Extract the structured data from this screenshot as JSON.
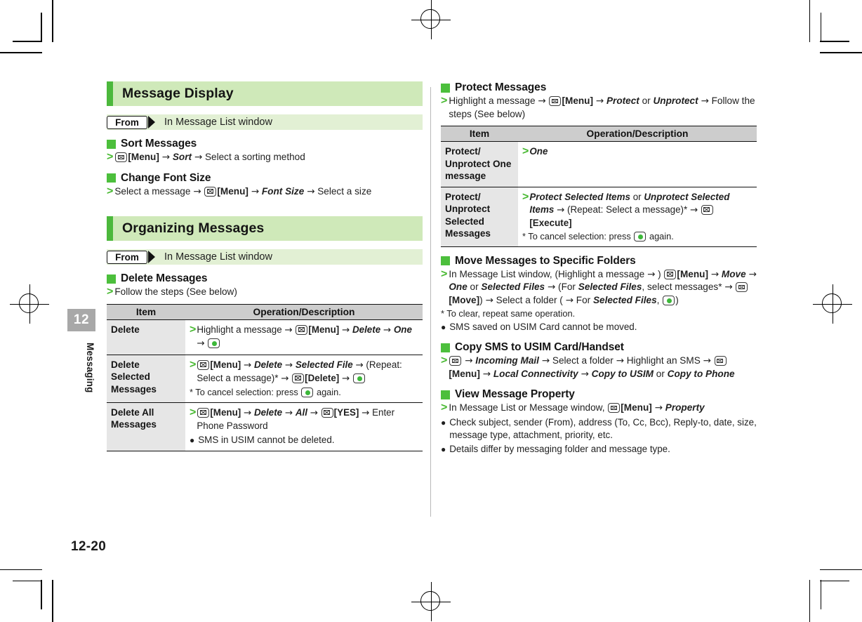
{
  "page": {
    "folio": "12-20",
    "chapter_number": "12",
    "chapter_label": "Messaging"
  },
  "left_column": {
    "sections": [
      {
        "banner_title": "Message Display",
        "from_badge": "From",
        "from_text": "In Message List window",
        "topics": [
          {
            "heading": "Sort Messages",
            "step": "[Menu] → Sort → Select a sorting method"
          },
          {
            "heading": "Change Font Size",
            "step": "Select a message → [Menu] → Font Size → Select a size"
          }
        ]
      },
      {
        "banner_title": "Organizing Messages",
        "from_badge": "From",
        "from_text": "In Message List window",
        "topics": [
          {
            "heading": "Delete Messages",
            "step": "Follow the steps (See below)"
          }
        ]
      }
    ],
    "table": {
      "columns": [
        "Item",
        "Operation/Description"
      ],
      "rows": [
        {
          "item": "Delete",
          "operation": "Highlight a message → [Menu] → Delete → One →",
          "note": "",
          "bullet": ""
        },
        {
          "item": "Delete Selected Messages",
          "operation": "[Menu] → Delete → Selected File → (Repeat: Select a message)* → [Delete] →",
          "note": "* To cancel selection: press  again.",
          "bullet": ""
        },
        {
          "item": "Delete All Messages",
          "operation": "[Menu] → Delete → All → [YES] → Enter Phone Password",
          "note": "",
          "bullet": "SMS in USIM cannot be deleted."
        }
      ]
    }
  },
  "right_column": {
    "protect": {
      "heading": "Protect Messages",
      "step": "Highlight a message → [Menu] → Protect or Unprotect → Follow the steps (See below)",
      "table": {
        "columns": [
          "Item",
          "Operation/Description"
        ],
        "rows": [
          {
            "item": "Protect/ Unprotect One message",
            "operation": "One",
            "note": ""
          },
          {
            "item": "Protect/ Unprotect Selected Messages",
            "operation": "Protect Selected Items or Unprotect Selected Items → (Repeat: Select a message)* → [Execute]",
            "note": "* To cancel selection: press  again."
          }
        ]
      }
    },
    "move": {
      "heading": "Move Messages to Specific Folders",
      "step": "In Message List window, (Highlight a message → ) [Menu] → Move → One or Selected Files → (For Selected Files, select messages* → [Move]) → Select a folder ( → For Selected Files, )",
      "note": "* To clear, repeat same operation.",
      "bullet": "SMS saved on USIM Card cannot be moved."
    },
    "copy": {
      "heading": "Copy SMS to USIM Card/Handset",
      "step": " → Incoming Mail → Select a folder → Highlight an SMS → [Menu] → Local Connectivity → Copy to USIM or Copy to Phone"
    },
    "property": {
      "heading": "View Message Property",
      "step": "In Message List or Message window, [Menu] → Property",
      "bullets": [
        "Check subject, sender (From), address (To, Cc, Bcc), Reply-to, date, size, message type, attachment, priority, etc.",
        "Details differ by messaging folder and message type."
      ]
    }
  },
  "colors": {
    "banner_bg": "#cfe9b9",
    "banner_bar": "#4cb83c",
    "from_bg": "#e2f0d4",
    "green_square": "#4cbf3c",
    "green_arrow": "#46b82f",
    "table_header_bg": "#cdcdcd",
    "table_item_bg": "#e6e6e6",
    "tab_bg": "#a8a8a8"
  }
}
